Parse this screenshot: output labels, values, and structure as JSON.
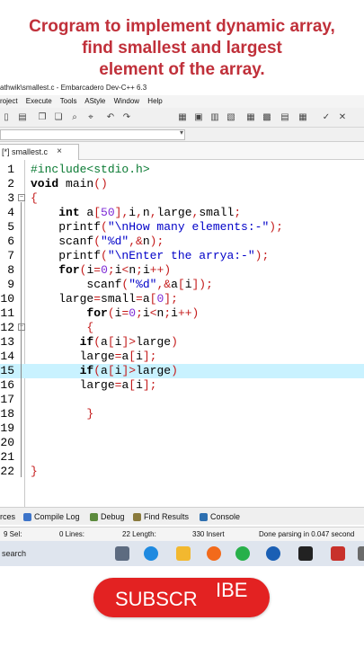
{
  "headline": {
    "line1": "Crogram to implement dynamic array,",
    "line2": "find smallest and largest",
    "line3": "element of the array."
  },
  "window": {
    "title": "athwik\\smallest.c - Embarcadero Dev-C++ 6.3"
  },
  "menu": [
    "roject",
    "Execute",
    "Tools",
    "AStyle",
    "Window",
    "Help"
  ],
  "tab": {
    "label": "[*] smallest.c",
    "close": "×"
  },
  "code_lines": [
    {
      "n": "1",
      "text": "#include<stdio.h>"
    },
    {
      "n": "2",
      "text": "void main()"
    },
    {
      "n": "3",
      "text": "{"
    },
    {
      "n": "4",
      "text": "    int a[50],i,n,large,small;"
    },
    {
      "n": "5",
      "text": "    printf(\"\\nHow many elements:-\");"
    },
    {
      "n": "6",
      "text": "    scanf(\"%d\",&n);"
    },
    {
      "n": "7",
      "text": "    printf(\"\\nEnter the arrya:-\");"
    },
    {
      "n": "8",
      "text": "    for(i=0;i<n;i++)"
    },
    {
      "n": "9",
      "text": "        scanf(\"%d\",&a[i]);"
    },
    {
      "n": "10",
      "text": "    large=small=a[0];"
    },
    {
      "n": "11",
      "text": "        for(i=0;i<n;i++)"
    },
    {
      "n": "12",
      "text": "        {"
    },
    {
      "n": "13",
      "text": "       if(a[i]>large)"
    },
    {
      "n": "14",
      "text": "       large=a[i];"
    },
    {
      "n": "15",
      "text": "       if(a[i]>large)"
    },
    {
      "n": "16",
      "text": "       large=a[i];"
    },
    {
      "n": "17",
      "text": ""
    },
    {
      "n": "18",
      "text": "        }"
    },
    {
      "n": "19",
      "text": ""
    },
    {
      "n": "20",
      "text": ""
    },
    {
      "n": "21",
      "text": ""
    },
    {
      "n": "22",
      "text": "}"
    }
  ],
  "bottom_tabs": [
    "rces",
    "Compile Log",
    "Debug",
    "Find Results",
    "Console"
  ],
  "status": {
    "sel": "9 Sel:",
    "lines": "0 Lines:",
    "length": "22 Length:",
    "insert": "330 Insert",
    "parse": "Done parsing in 0.047 second"
  },
  "taskbar": {
    "search": "search"
  },
  "subscribe": {
    "part1": "SUBSCR",
    "part2": "IBE"
  },
  "colors": {
    "headline": "#c0303a",
    "highlight_line": "#c9f2ff",
    "subscribe_bg": "#e32222",
    "string": "#0000c8",
    "number": "#7d2bd6",
    "preprocessor": "#0a7a33",
    "symbol": "#c41b1b"
  }
}
